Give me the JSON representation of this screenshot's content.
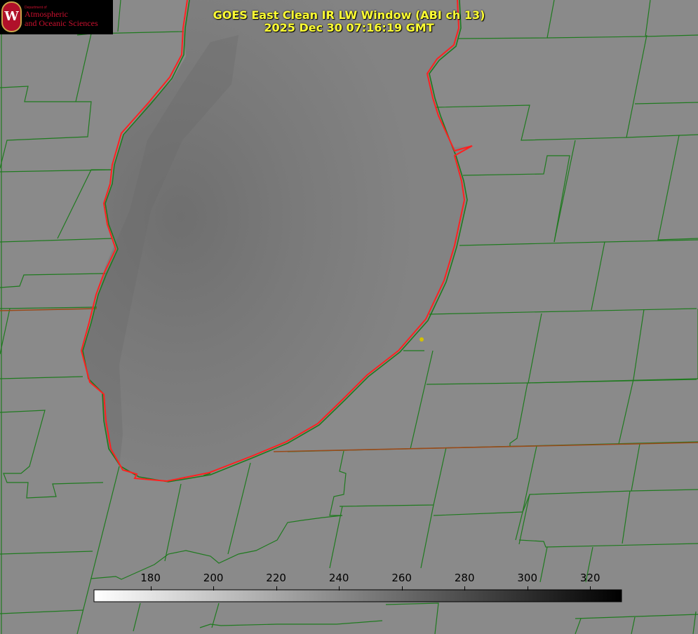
{
  "title": {
    "line1": "GOES East Clean IR LW Window (ABI ch 13)",
    "line2": "2025 Dec 30 07:16:19 GMT"
  },
  "logo": {
    "department": "Department of",
    "name_line1": "Atmospheric",
    "name_line2": "and Oceanic Sciences",
    "seal_letter": "W"
  },
  "colorbar": {
    "min": 162,
    "max": 330,
    "ticks": [
      "180",
      "200",
      "220",
      "240",
      "260",
      "280",
      "300",
      "320"
    ],
    "start_color": "#ffffff",
    "end_color": "#000000"
  },
  "colors": {
    "background": "#8a8a8a",
    "county_lines": "#1f7a1f",
    "coastline": "#ff2020",
    "title": "#ffff33",
    "marker": "#d4c200"
  }
}
